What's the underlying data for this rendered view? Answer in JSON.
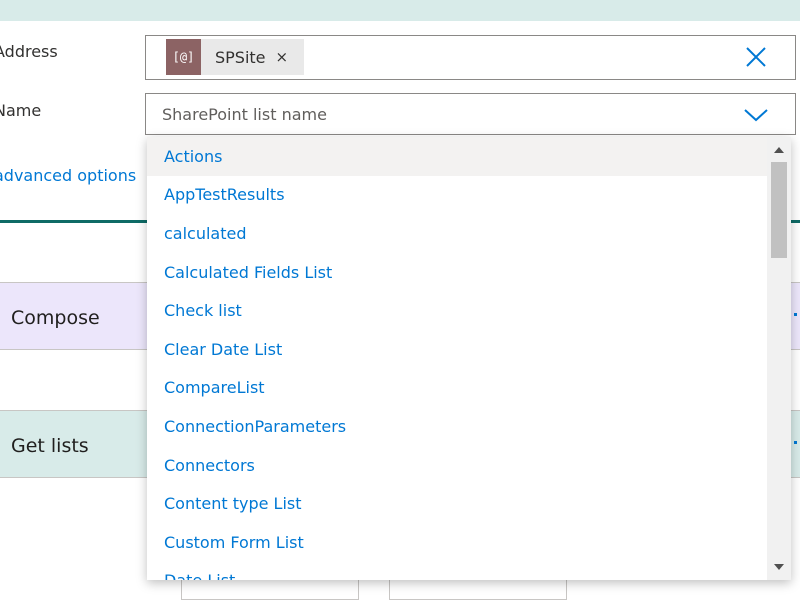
{
  "form": {
    "address_label": "Address",
    "address_token": {
      "icon_text": "[@]",
      "text": "SPSite",
      "remove_glyph": "×"
    },
    "name_label": "Name",
    "name_placeholder": "SharePoint list name",
    "advanced_options": "advanced options"
  },
  "cards": {
    "compose": "Compose",
    "get_lists": "Get lists"
  },
  "dropdown": {
    "items": [
      "Actions",
      "AppTestResults",
      "calculated",
      "Calculated Fields List",
      "Check list",
      "Clear Date List",
      "CompareList",
      "ConnectionParameters",
      "Connectors",
      "Content type List",
      "Custom Form List",
      "Date List"
    ],
    "highlighted_index": 0
  },
  "icons": {
    "token_icon": "dynamic-content-icon",
    "clear": "close-icon",
    "dropdown": "chevron-down-icon",
    "scroll_up": "arrow-up-icon",
    "scroll_down": "arrow-down-icon"
  },
  "colors": {
    "link": "#0078d4",
    "token_icon_bg": "#8c6364",
    "compose_bg": "#ece6fb",
    "get_lists_bg": "#d8ebe9",
    "top_band": "#d8ebe9",
    "teal_line": "#0e6b66"
  }
}
